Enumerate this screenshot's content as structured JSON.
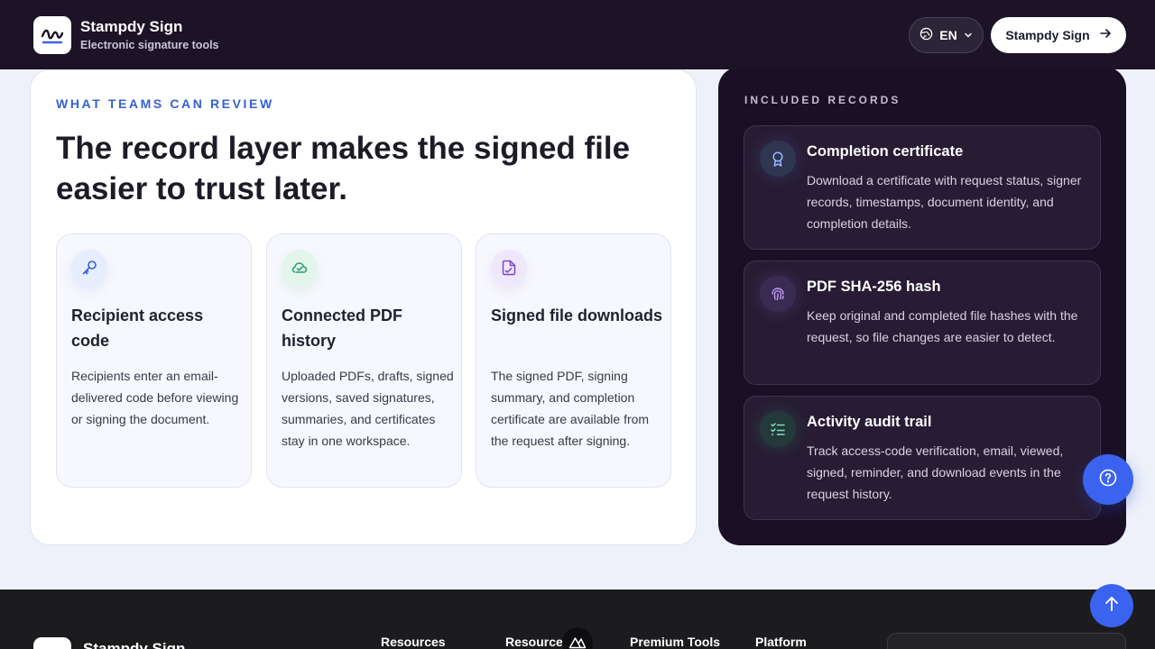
{
  "header": {
    "brand_name": "Stampdy Sign",
    "brand_tagline": "Electronic signature tools",
    "language": "EN",
    "cta_label": "Stampdy Sign"
  },
  "review": {
    "eyebrow": "WHAT TEAMS CAN REVIEW",
    "headline": "The record layer makes the signed file easier to trust later.",
    "features": [
      {
        "title": "Recipient access code",
        "description": "Recipients enter an email-delivered code before viewing or signing the document.",
        "icon": "key-icon"
      },
      {
        "title": "Connected PDF history",
        "description": "Uploaded PDFs, drafts, signed versions, saved signatures, summaries, and certificates stay in one workspace.",
        "icon": "cloud-check-icon"
      },
      {
        "title": "Signed file downloads",
        "description": "The signed PDF, signing summary, and completion certificate are available from the request after signing.",
        "icon": "file-signature-icon"
      }
    ]
  },
  "records": {
    "eyebrow": "INCLUDED RECORDS",
    "items": [
      {
        "title": "Completion certificate",
        "description": "Download a certificate with request status, signer records, timestamps, document identity, and completion details.",
        "icon": "award-icon"
      },
      {
        "title": "PDF SHA-256 hash",
        "description": "Keep original and completed file hashes with the request, so file changes are easier to detect.",
        "icon": "fingerprint-icon"
      },
      {
        "title": "Activity audit trail",
        "description": "Track access-code verification, email, viewed, signed, reminder, and download events in the request history.",
        "icon": "list-checks-icon"
      }
    ]
  },
  "footer": {
    "brand_name": "Stampdy Sign",
    "columns": [
      "Resources",
      "Resource",
      "Premium Tools",
      "Platform"
    ]
  },
  "colors": {
    "accent": "#3561d6",
    "header_bg": "#1c1327",
    "dark_card_bg": "#1a0f24",
    "fab_blue": "#3a63ef"
  }
}
